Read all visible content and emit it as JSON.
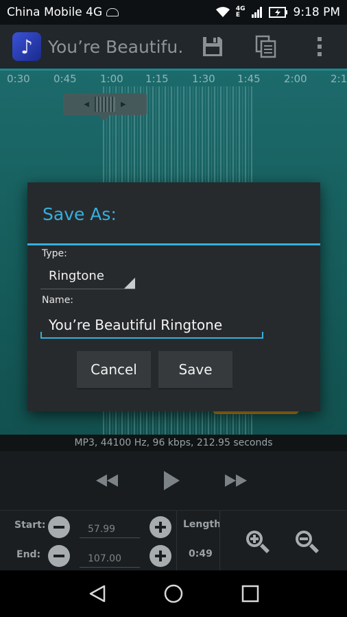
{
  "status_bar": {
    "carrier": "China Mobile 4G",
    "network_badge_top": "4G",
    "network_badge_bottom": "E",
    "time": "9:18 PM"
  },
  "action_bar": {
    "title": "You’re Beautifu…",
    "icons": [
      "music-note-icon",
      "save-icon",
      "copy-icon",
      "overflow-menu-icon"
    ]
  },
  "timeline": {
    "ticks": [
      "0:30",
      "0:45",
      "1:00",
      "1:15",
      "1:30",
      "1:45",
      "2:00",
      "2:1"
    ]
  },
  "info": {
    "text": "MP3, 44100 Hz, 96 kbps, 212.95 seconds"
  },
  "controls": {
    "start_label": "Start:",
    "start_value": "57.99",
    "end_label": "End:",
    "end_value": "107.00",
    "length_label": "Length",
    "length_value": "0:49"
  },
  "dialog": {
    "title": "Save As:",
    "type_label": "Type:",
    "type_value": "Ringtone",
    "name_label": "Name:",
    "name_value": "You’re Beautiful Ringtone",
    "cancel_label": "Cancel",
    "save_label": "Save"
  },
  "colors": {
    "accent": "#35b0e0",
    "waveform": "#17605f",
    "marker": "#c28a16"
  }
}
